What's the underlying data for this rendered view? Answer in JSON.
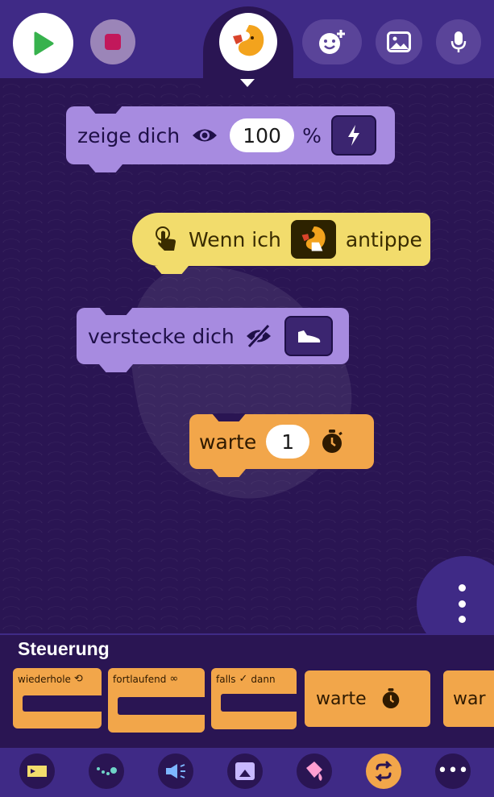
{
  "toolbar": {
    "play_icon": "play-icon",
    "stop_icon": "stop-icon",
    "sprite_icon": "sprite-thumbnail",
    "add_sprite_icon": "add-character-icon",
    "background_icon": "image-icon",
    "mic_icon": "microphone-icon"
  },
  "blocks": {
    "show": {
      "label": "zeige dich",
      "value": "100",
      "unit": "%",
      "icon": "eye-icon",
      "mode_icon": "flash-icon"
    },
    "tap": {
      "label_pre": "Wenn ich",
      "label_post": "antippe",
      "icon": "tap-hand-icon"
    },
    "hide": {
      "label": "verstecke dich",
      "icon": "eye-slash-icon",
      "mode_icon": "shoe-icon"
    },
    "wait": {
      "label": "warte",
      "value": "1",
      "icon": "stopwatch-icon"
    }
  },
  "palette": {
    "title": "Steuerung",
    "items": [
      {
        "label": "wiederhole",
        "icon": "repeat-icon"
      },
      {
        "label": "fortlaufend",
        "icon": "infinity-icon"
      },
      {
        "label": "falls",
        "label2": "dann",
        "icon": "check-icon"
      },
      {
        "label": "warte",
        "icon": "stopwatch-icon"
      },
      {
        "label": "war"
      }
    ]
  },
  "categories": [
    {
      "name": "events",
      "icon": "ticket-icon"
    },
    {
      "name": "motion",
      "icon": "path-icon"
    },
    {
      "name": "sound",
      "icon": "megaphone-icon"
    },
    {
      "name": "scene",
      "icon": "stage-icon"
    },
    {
      "name": "paint",
      "icon": "paint-icon"
    },
    {
      "name": "control",
      "icon": "repeat-icon",
      "active": true
    },
    {
      "name": "more",
      "icon": "more-icon"
    }
  ],
  "colors": {
    "background": "#2a1553",
    "topbar": "#3f2a86",
    "looks_block": "#a78be0",
    "event_block": "#f2dc6c",
    "control_block": "#f2a64a"
  }
}
